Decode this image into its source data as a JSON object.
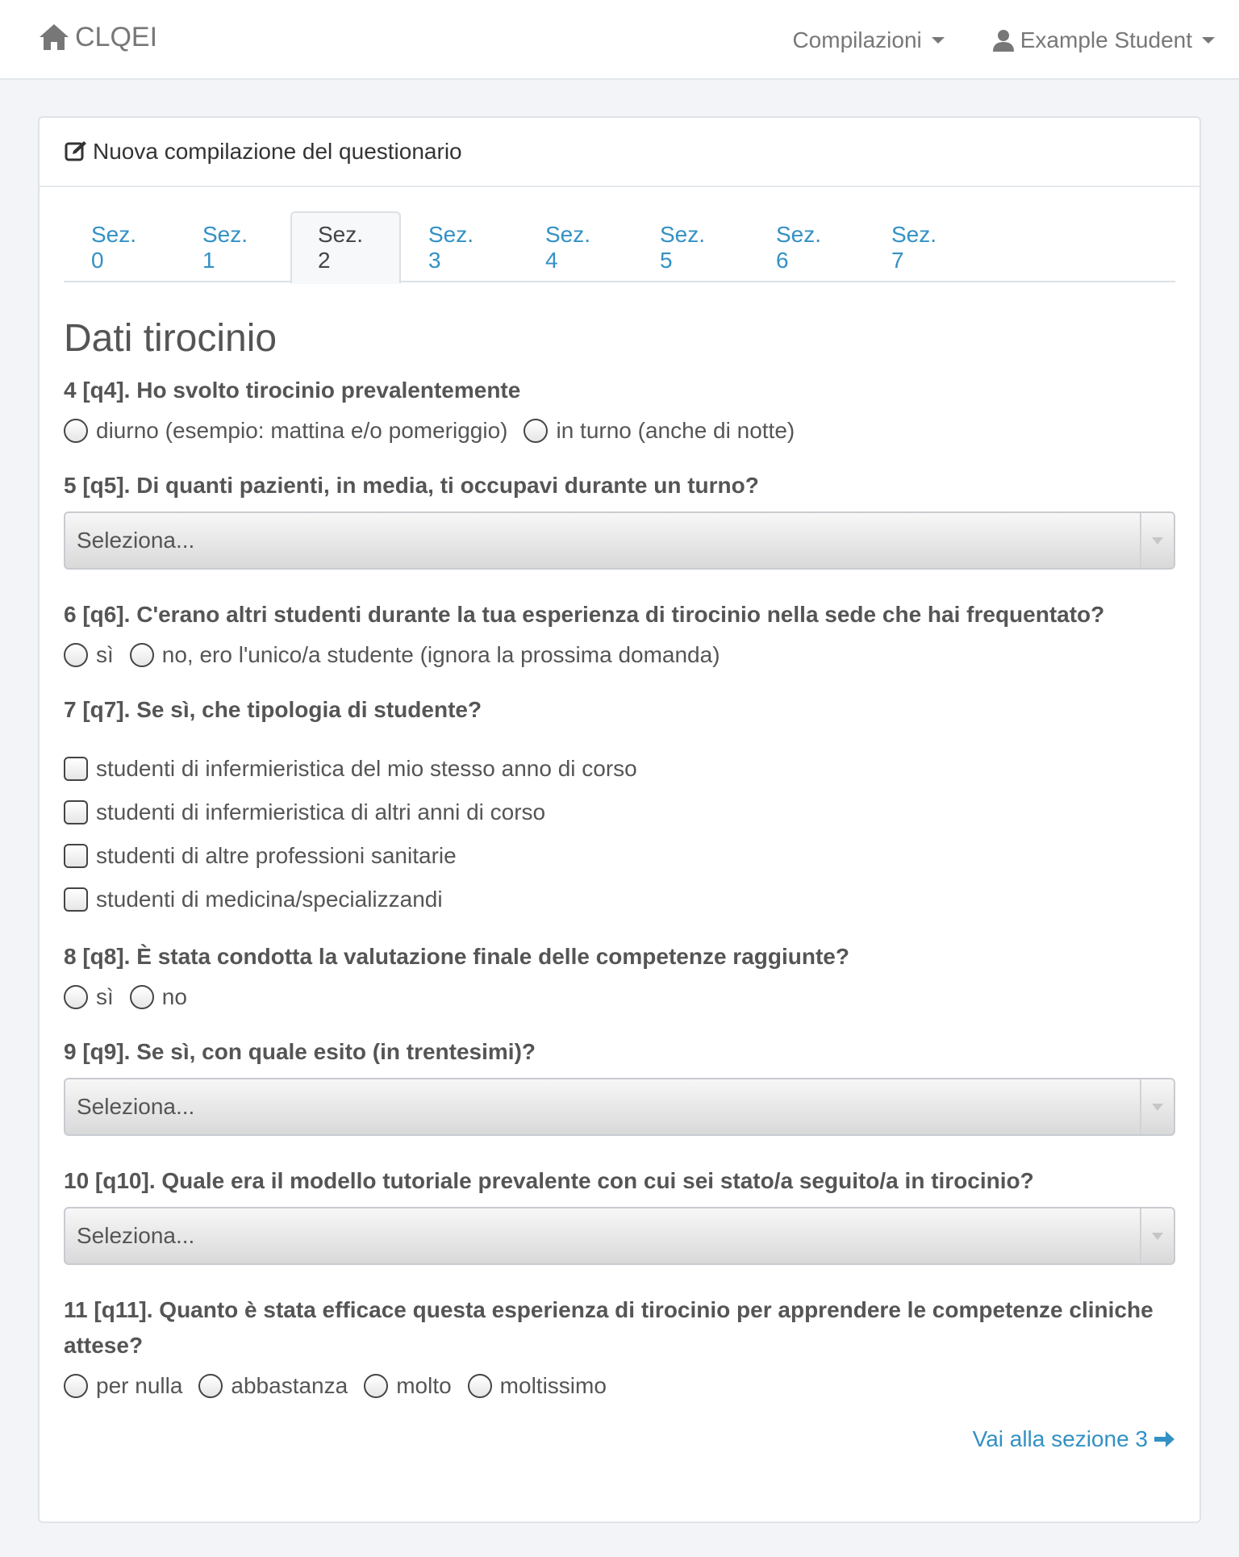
{
  "navbar": {
    "brand": "CLQEI",
    "menu_compilazioni": "Compilazioni",
    "menu_user": "Example Student"
  },
  "panel": {
    "heading": "Nuova compilazione del questionario"
  },
  "tabs": [
    {
      "label": "Sez. 0"
    },
    {
      "label": "Sez. 1"
    },
    {
      "label": "Sez. 2",
      "active": true
    },
    {
      "label": "Sez. 3"
    },
    {
      "label": "Sez. 4"
    },
    {
      "label": "Sez. 5"
    },
    {
      "label": "Sez. 6"
    },
    {
      "label": "Sez. 7"
    }
  ],
  "section": {
    "title": "Dati tirocinio"
  },
  "q4": {
    "label": "4 [q4]. Ho svolto tirocinio prevalentemente",
    "options": [
      "diurno (esempio: mattina e/o pomeriggio)",
      "in turno (anche di notte)"
    ]
  },
  "q5": {
    "label": "5 [q5]. Di quanti pazienti, in media, ti occupavi durante un turno?",
    "value": "Seleziona..."
  },
  "q6": {
    "label": "6 [q6]. C'erano altri studenti durante la tua esperienza di tirocinio nella sede che hai frequentato?",
    "options": [
      "sì",
      "no, ero l'unico/a studente (ignora la prossima domanda)"
    ]
  },
  "q7": {
    "label": "7 [q7]. Se sì, che tipologia di studente?",
    "options": [
      "studenti di infermieristica del mio stesso anno di corso",
      "studenti di infermieristica di altri anni di corso",
      "studenti di altre professioni sanitarie",
      "studenti di medicina/specializzandi"
    ]
  },
  "q8": {
    "label": "8 [q8]. È stata condotta la valutazione finale delle competenze raggiunte?",
    "options": [
      "sì",
      "no"
    ]
  },
  "q9": {
    "label": "9 [q9]. Se sì, con quale esito (in trentesimi)?",
    "value": "Seleziona..."
  },
  "q10": {
    "label": "10 [q10]. Quale era il modello tutoriale prevalente con cui sei stato/a seguito/a in tirocinio?",
    "value": "Seleziona..."
  },
  "q11": {
    "label": "11 [q11]. Quanto è stata efficace questa esperienza di tirocinio per apprendere le competenze cliniche attese?",
    "options": [
      "per nulla",
      "abbastanza",
      "molto",
      "moltissimo"
    ]
  },
  "next": {
    "label": "Vai alla sezione 3"
  },
  "colors": {
    "link": "#3391c4",
    "text": "#555555",
    "background": "#f2f4f7"
  },
  "icons": {
    "brand": "home-icon",
    "user": "user-icon",
    "heading": "edit-icon",
    "next": "arrow-right-icon"
  }
}
